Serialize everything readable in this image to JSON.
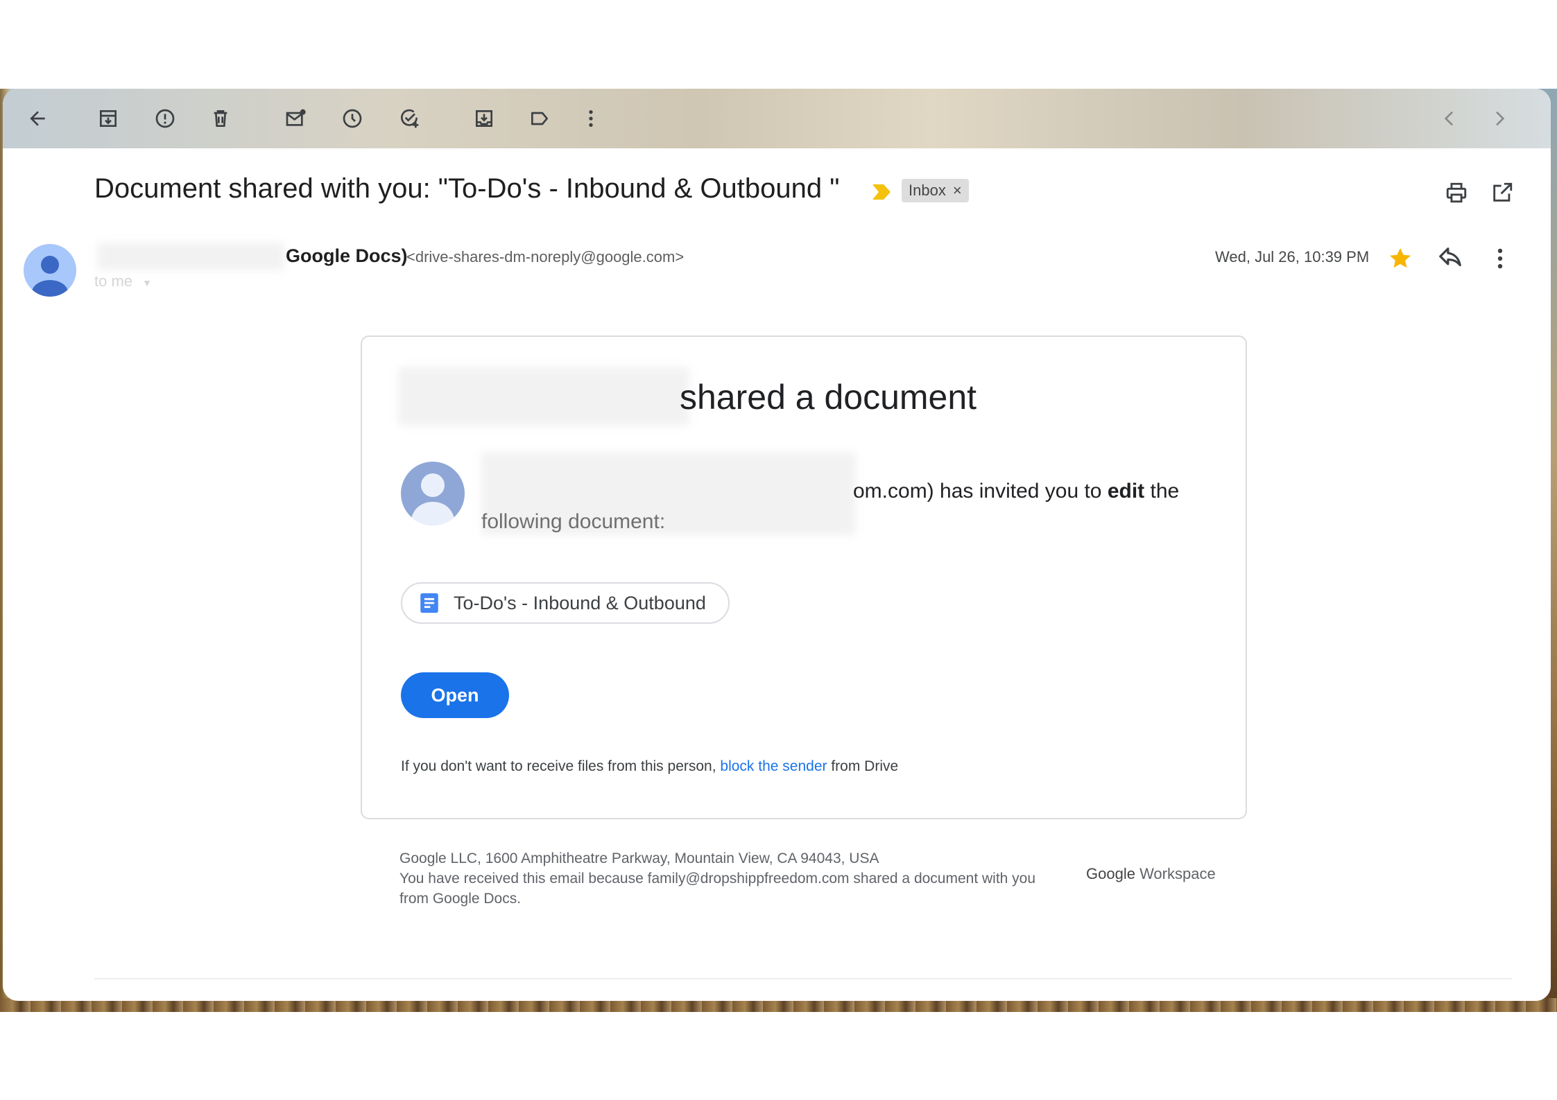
{
  "toolbar": {
    "icons": [
      "back-arrow-icon",
      "archive-icon",
      "report-spam-icon",
      "delete-icon",
      "mark-unread-icon",
      "snooze-icon",
      "add-to-tasks-icon",
      "move-to-icon",
      "label-icon",
      "more-vert-icon",
      "prev-chevron-icon",
      "next-chevron-icon"
    ]
  },
  "email": {
    "subject": "Document shared with you: \"To-Do's - Inbound & Outbound \"",
    "label_chip": "Inbox",
    "label_chip_close": "×",
    "sender_name_suffix": "Google Docs)",
    "sender_email": "<drive-shares-dm-noreply@google.com>",
    "recipient": "to me",
    "date": "Wed, Jul 26, 10:39 PM",
    "starred": true
  },
  "card": {
    "title": "shared a document",
    "invite_visible": "om.com) has invited you to ",
    "invite_bold": "edit",
    "invite_tail": " the",
    "invite_line2": "following document:",
    "document_name": "To-Do's - Inbound & Outbound",
    "open_label": "Open",
    "block_prefix": "If you don't want to receive files from this person, ",
    "block_link": "block the sender",
    "block_suffix": " from Drive"
  },
  "footer": {
    "address": "Google LLC, 1600 Amphitheatre Parkway, Mountain View, CA 94043, USA",
    "reason": "You have received this email because family@dropshippfreedom.com shared a document with you from Google Docs.",
    "logo_google": "Google",
    "logo_workspace": " Workspace"
  },
  "colors": {
    "primary_blue": "#1a73e8",
    "star_yellow": "#f7b500",
    "importance_yellow": "#f4c20d",
    "avatar_blue": "#a8c7fa"
  }
}
